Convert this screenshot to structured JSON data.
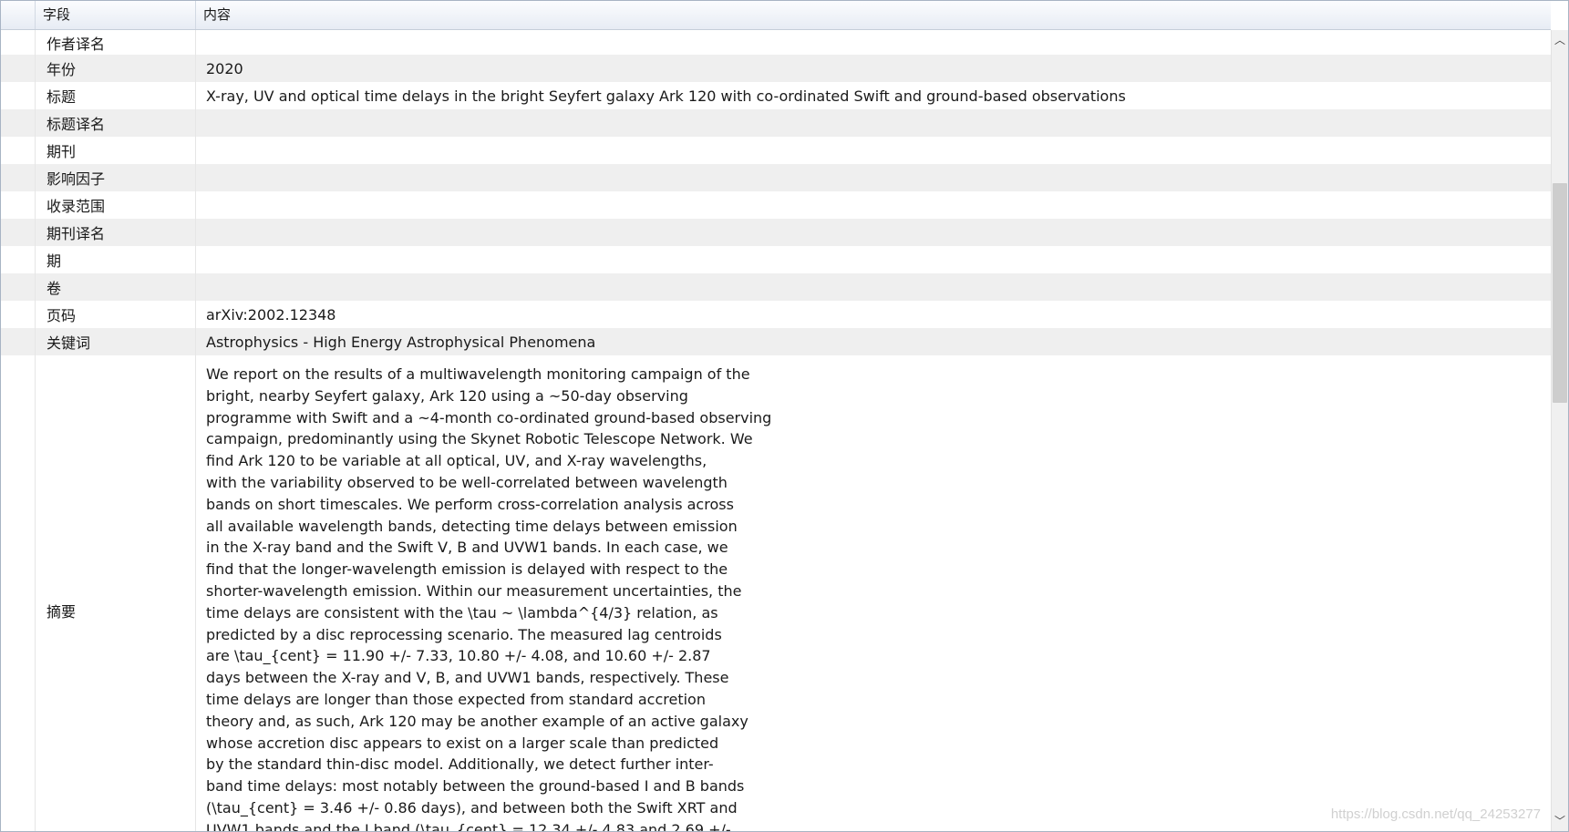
{
  "header": {
    "col_field": "字段",
    "col_content": "内容"
  },
  "rows": [
    {
      "field": "作者译名",
      "value": ""
    },
    {
      "field": "年份",
      "value": "2020"
    },
    {
      "field": "标题",
      "value": "X-ray, UV and optical time delays in the bright Seyfert galaxy Ark 120 with co-ordinated Swift and ground-based observations"
    },
    {
      "field": "标题译名",
      "value": ""
    },
    {
      "field": "期刊",
      "value": ""
    },
    {
      "field": "影响因子",
      "value": ""
    },
    {
      "field": "收录范围",
      "value": ""
    },
    {
      "field": "期刊译名",
      "value": ""
    },
    {
      "field": "期",
      "value": ""
    },
    {
      "field": "卷",
      "value": ""
    },
    {
      "field": "页码",
      "value": "arXiv:2002.12348"
    },
    {
      "field": "关键词",
      "value": "Astrophysics - High Energy Astrophysical Phenomena"
    },
    {
      "field": "摘要",
      "value": "We report on the results of a multiwavelength monitoring campaign of the\nbright, nearby Seyfert galaxy, Ark 120 using a ~50-day observing\nprogramme with Swift and a ~4-month co-ordinated ground-based observing\ncampaign, predominantly using the Skynet Robotic Telescope Network. We\nfind Ark 120 to be variable at all optical, UV, and X-ray wavelengths,\nwith the variability observed to be well-correlated between wavelength\nbands on short timescales. We perform cross-correlation analysis across\nall available wavelength bands, detecting time delays between emission\nin the X-ray band and the Swift V, B and UVW1 bands. In each case, we\nfind that the longer-wavelength emission is delayed with respect to the\nshorter-wavelength emission. Within our measurement uncertainties, the\ntime delays are consistent with the \\tau ~ \\lambda^{4/3} relation, as\npredicted by a disc reprocessing scenario. The measured lag centroids\nare \\tau_{cent} = 11.90 +/- 7.33, 10.80 +/- 4.08, and 10.60 +/- 2.87\ndays between the X-ray and V, B, and UVW1 bands, respectively. These\ntime delays are longer than those expected from standard accretion\ntheory and, as such, Ark 120 may be another example of an active galaxy\nwhose accretion disc appears to exist on a larger scale than predicted\nby the standard thin-disc model. Additionally, we detect further inter-\nband time delays: most notably between the ground-based I and B bands\n(\\tau_{cent} = 3.46 +/- 0.86 days), and between both the Swift XRT and\nUVW1 bands and the I band (\\tau_{cent} = 12.34 +/- 4.83 and 2.69 +/-"
    }
  ],
  "watermark": "https://blog.csdn.net/qq_24253277"
}
